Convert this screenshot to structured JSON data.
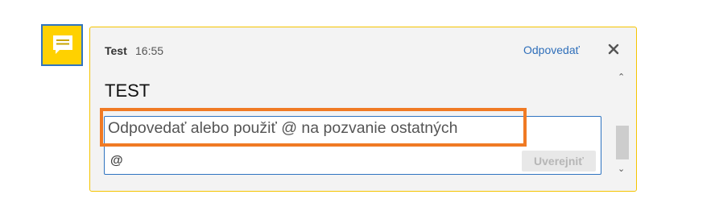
{
  "comment": {
    "author": "Test",
    "time": "16:55",
    "reply_link": "Odpovedať",
    "text": "TEST"
  },
  "reply": {
    "placeholder": "Odpovedať alebo použiť @ na pozvanie ostatných",
    "mention_symbol": "@",
    "post_label": "Uverejniť"
  },
  "colors": {
    "icon_background": "#ffd100",
    "icon_border": "#2f74c0",
    "card_border": "#f5c400",
    "link": "#2f6fba",
    "highlight": "#f07a24"
  },
  "icons": {
    "comment": "comment-icon",
    "close": "close-icon"
  }
}
